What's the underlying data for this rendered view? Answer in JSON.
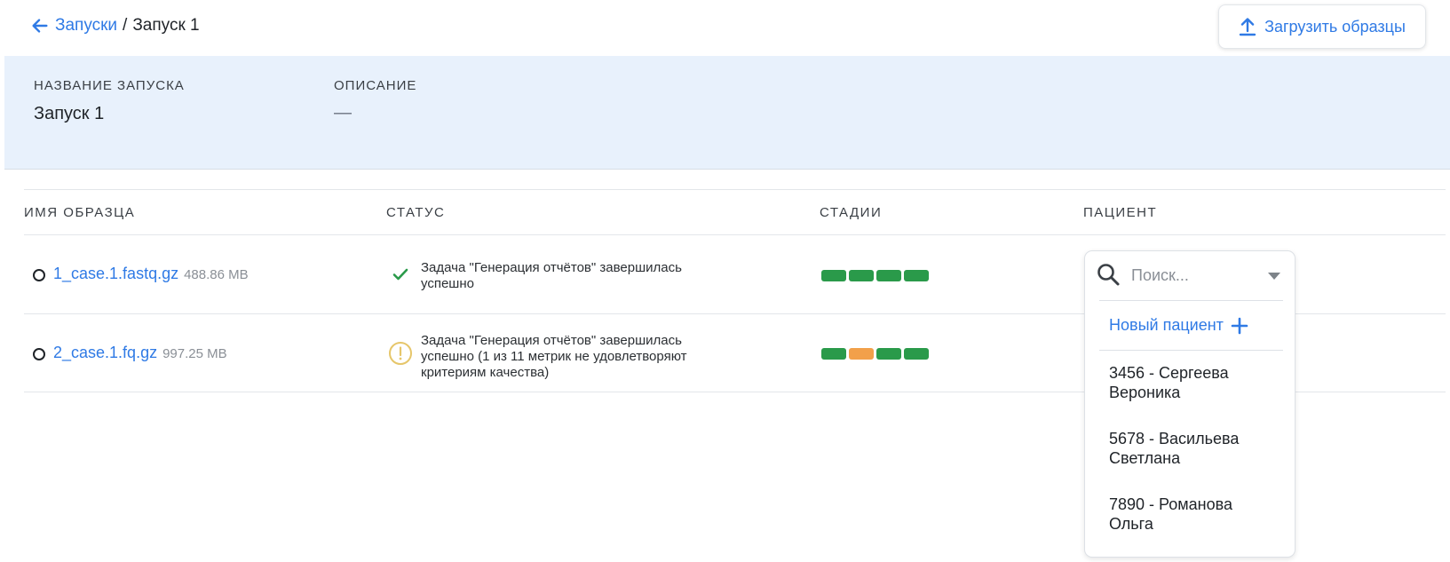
{
  "breadcrumb": {
    "parent": "Запуски",
    "separator": "/",
    "current": "Запуск 1"
  },
  "toolbar": {
    "upload_label": "Загрузить образцы"
  },
  "run_info": {
    "name_label": "НАЗВАНИЕ ЗАПУСКА",
    "name_value": "Запуск 1",
    "description_label": "ОПИСАНИЕ",
    "description_value": "—"
  },
  "table": {
    "headers": [
      "ИМЯ ОБРАЗЦА",
      "СТАТУС",
      "СТАДИИ",
      "ПАЦИЕНТ"
    ],
    "rows": [
      {
        "file_name": "1_case.1.fastq.gz",
        "file_size": "488.86 MB",
        "status_icon": "check-icon",
        "status_text": "Задача \"Генерация отчётов\" завершилась успешно",
        "stages": [
          "#2a9a4a",
          "#2a9a4a",
          "#2a9a4a",
          "#2a9a4a"
        ]
      },
      {
        "file_name": "2_case.1.fq.gz",
        "file_size": "997.25 MB",
        "status_icon": "warning-icon",
        "status_text": "Задача \"Генерация отчётов\" завершилась успешно (1 из 11 метрик не удовлетворяют критериям качества)",
        "stages": [
          "#2a9a4a",
          "#f2a04a",
          "#2a9a4a",
          "#2a9a4a"
        ]
      }
    ]
  },
  "patient_dropdown": {
    "placeholder": "Поиск...",
    "new_patient_label": "Новый пациент",
    "options": [
      "3456 - Сергеева Вероника",
      "5678 - Васильева Светлана",
      "7890 - Романова Ольга"
    ]
  },
  "colors": {
    "accent": "#2f7ae5",
    "panel_bg": "#e8f1fc",
    "success": "#2a9a4a",
    "warning": "#e6c66a",
    "stage_warning": "#f2a04a"
  }
}
